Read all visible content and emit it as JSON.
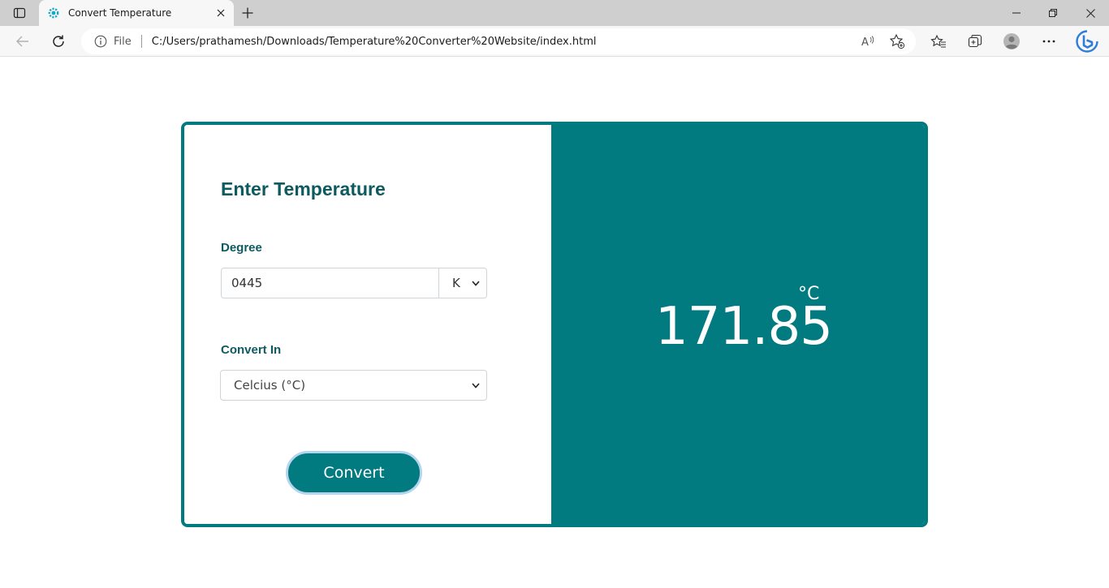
{
  "browser": {
    "tab_title": "Convert Temperature",
    "file_label": "File",
    "url": "C:/Users/prathamesh/Downloads/Temperature%20Converter%20Website/index.html"
  },
  "page": {
    "heading": "Enter Temperature",
    "degree_label": "Degree",
    "degree_value": "0445",
    "unit_selected": "K",
    "convert_in_label": "Convert In",
    "convert_in_selected": "Celcius (°C)",
    "convert_button": "Convert",
    "result_value": "171.85",
    "result_unit": "°C"
  },
  "colors": {
    "accent": "#017a80",
    "heading": "#0d5a5f",
    "button_ring": "#b5d5ef"
  }
}
